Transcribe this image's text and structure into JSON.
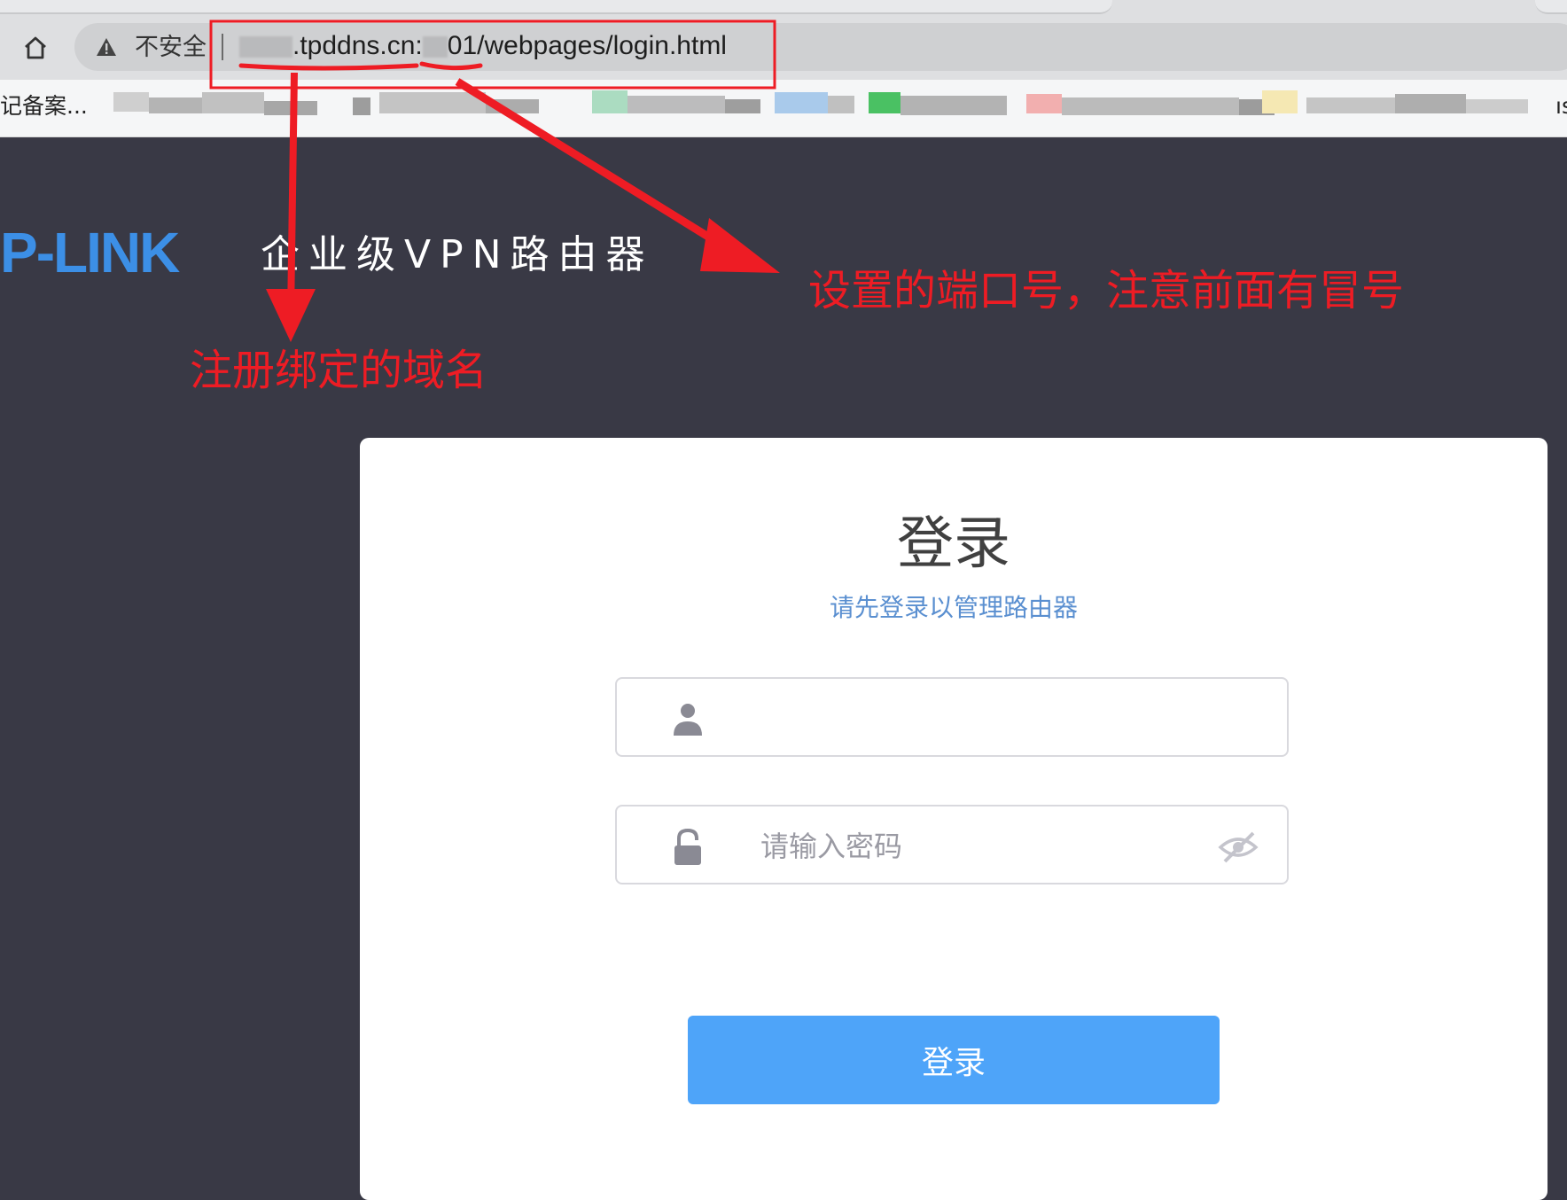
{
  "browser": {
    "security_label": "不安全",
    "url": {
      "domain_suffix": ".tpddns.cn:",
      "port_tail": "01",
      "path": "/webpages/login.html"
    },
    "bookmarks": {
      "first_label": "记备案...",
      "last_fragment": "ıs"
    }
  },
  "header": {
    "logo_text": "P-LINK",
    "product_title": "企业级VPN路由器"
  },
  "annotations": {
    "port_note": "设置的端口号，注意前面有冒号",
    "domain_note": "注册绑定的域名",
    "color": "#ee1c24"
  },
  "login": {
    "title": "登录",
    "subtitle": "请先登录以管理路由器",
    "username": {
      "value": "",
      "placeholder": ""
    },
    "password": {
      "value": "",
      "placeholder": "请输入密码"
    },
    "button_label": "登录"
  },
  "colors": {
    "page_background": "#393945",
    "logo": "#3c8fe6",
    "button": "#4ea4f9",
    "subtitle": "#5a8fd0"
  }
}
